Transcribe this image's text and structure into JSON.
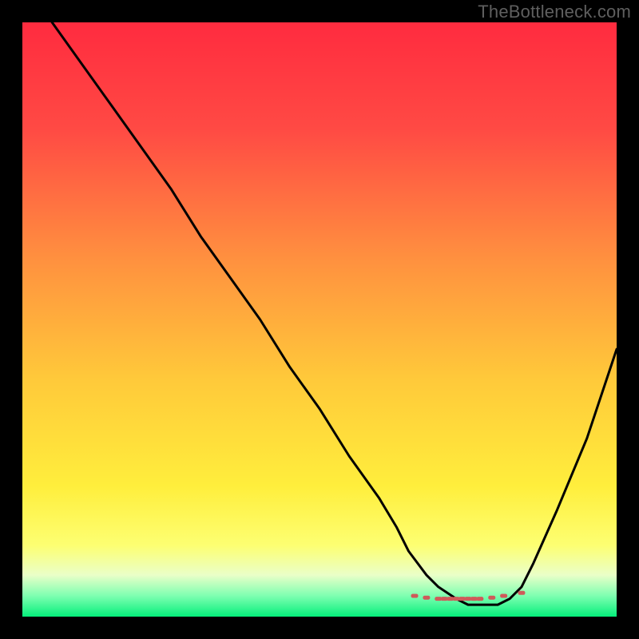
{
  "watermark": "TheBottleneck.com",
  "chart_data": {
    "type": "line",
    "title": "",
    "xlabel": "",
    "ylabel": "",
    "xlim": [
      0,
      100
    ],
    "ylim": [
      0,
      100
    ],
    "gradient_stops": [
      {
        "offset": 0.0,
        "color": "#ff2b3f"
      },
      {
        "offset": 0.18,
        "color": "#ff4a44"
      },
      {
        "offset": 0.4,
        "color": "#ff913f"
      },
      {
        "offset": 0.6,
        "color": "#ffc93a"
      },
      {
        "offset": 0.78,
        "color": "#ffee3c"
      },
      {
        "offset": 0.88,
        "color": "#fdff72"
      },
      {
        "offset": 0.93,
        "color": "#eaffc8"
      },
      {
        "offset": 0.965,
        "color": "#7effb1"
      },
      {
        "offset": 1.0,
        "color": "#05ef7b"
      }
    ],
    "series": [
      {
        "name": "bottleneck-curve",
        "x": [
          5,
          10,
          15,
          20,
          25,
          30,
          35,
          40,
          45,
          50,
          55,
          60,
          63,
          65,
          68,
          70,
          73,
          75,
          78,
          80,
          82,
          84,
          86,
          90,
          95,
          100
        ],
        "values": [
          100,
          93,
          86,
          79,
          72,
          64,
          57,
          50,
          42,
          35,
          27,
          20,
          15,
          11,
          7,
          5,
          3,
          2,
          2,
          2,
          3,
          5,
          9,
          18,
          30,
          45
        ]
      },
      {
        "name": "optimal-range-markers",
        "x": [
          66,
          68,
          70,
          71,
          72,
          73,
          74,
          75,
          76,
          77,
          79,
          81,
          84
        ],
        "values": [
          3.5,
          3.2,
          3.0,
          3.0,
          3.0,
          3.0,
          3.0,
          3.0,
          3.0,
          3.0,
          3.2,
          3.5,
          4.0
        ]
      }
    ]
  }
}
